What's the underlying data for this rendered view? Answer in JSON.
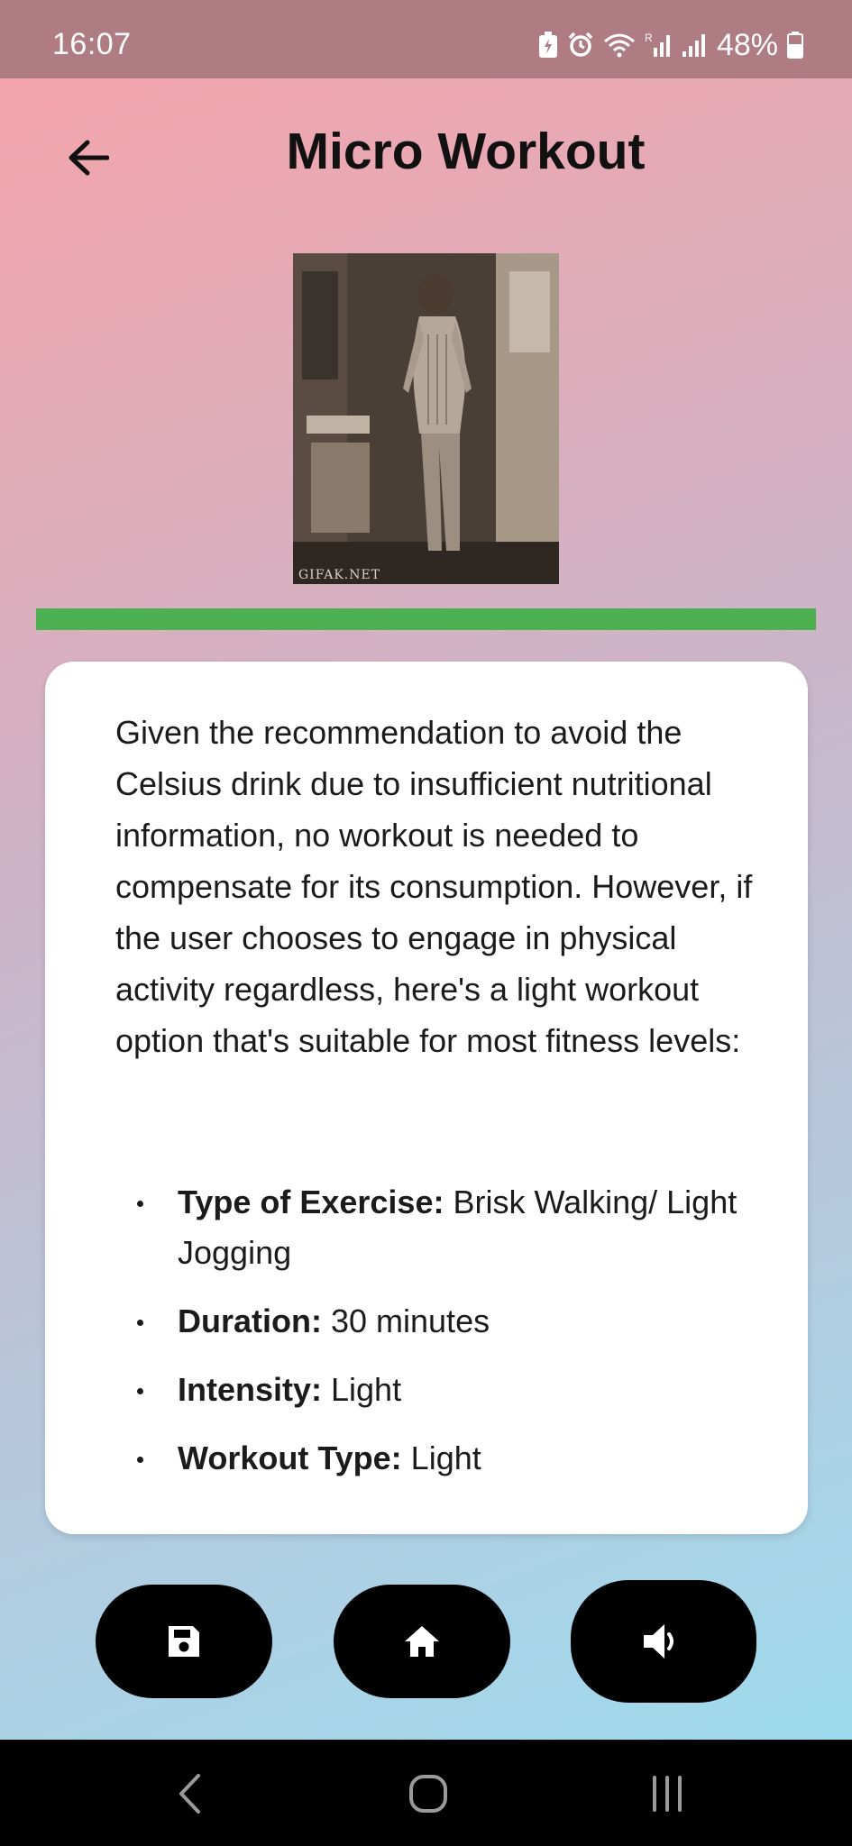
{
  "status_bar": {
    "time": "16:07",
    "battery_percent": "48%",
    "icons": [
      "battery-saver-icon",
      "alarm-icon",
      "wifi-icon",
      "signal-r-icon",
      "signal-icon",
      "battery-icon"
    ]
  },
  "header": {
    "title": "Micro Workout",
    "back_icon": "arrow-left-icon"
  },
  "media": {
    "watermark": "GIFAK.NET"
  },
  "progress": {
    "value_percent": 100,
    "color": "#4caf50"
  },
  "card": {
    "paragraph": "Given the recommendation to avoid the Celsius drink due to insufficient nutritional information, no workout is needed to compensate for its consumption.  However, if the user chooses to engage in physical activity regardless, here's a light workout option that's suitable for most fitness levels:",
    "items": [
      {
        "key": "Type of Exercise:",
        "value": "  Brisk Walking/ Light Jogging"
      },
      {
        "key": "Duration:",
        "value": " 30 minutes"
      },
      {
        "key": "Intensity:",
        "value": " Light"
      },
      {
        "key": "Workout Type:",
        "value": " Light"
      }
    ]
  },
  "actions": {
    "save_icon": "save-icon",
    "home_icon": "home-icon",
    "speaker_icon": "volume-icon"
  },
  "navigation_bar": {
    "buttons": [
      "nav-back-icon",
      "nav-home-icon",
      "nav-recents-icon"
    ]
  },
  "colors": {
    "status_bar": "#b07c84",
    "gradient_top": "#f7a4a8",
    "gradient_bottom": "#98ddf0",
    "card_background": "#ffffff",
    "button_background": "#000000"
  }
}
